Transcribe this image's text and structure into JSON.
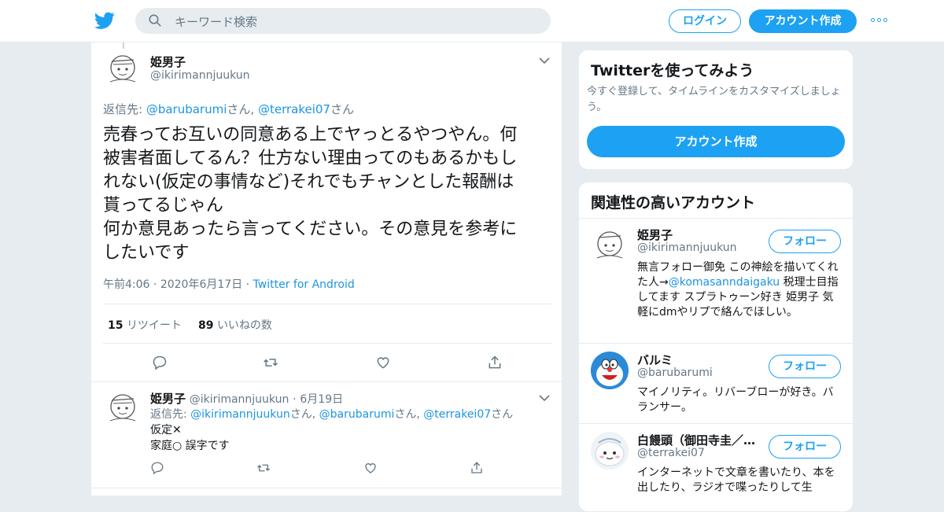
{
  "search": {
    "placeholder": "キーワード検索"
  },
  "header": {
    "login_label": "ログイン",
    "signup_label": "アカウント作成"
  },
  "main_tweet": {
    "name": "姫男子",
    "handle": "@ikirimannjuukun",
    "reply_prefix": "返信先: ",
    "reply_users": [
      "@barubarumi",
      "@terrakei07"
    ],
    "reply_suffix": "さん",
    "text_lines": [
      "売春ってお互いの同意ある上でヤっとるやつやん。何",
      "被害者面してるん？仕方ない理由ってのもあるかもし",
      "れない(仮定の事情など)それでもチャンとした報酬は",
      "貰ってるじゃん",
      "何か意見あったら言ってください。その意見を参考に",
      "したいです"
    ],
    "time": "午前4:06",
    "date": "2020年6月17日",
    "via": "Twitter for Android",
    "retweets": "15",
    "retweets_label": "リツイート",
    "likes": "89",
    "likes_label": "いいねの数"
  },
  "reply_tweet": {
    "name": "姫男子",
    "handle": "@ikirimannjuukun",
    "date": "6月19日",
    "reply_prefix": "返信先: ",
    "reply_users": [
      "@ikirimannjuukun",
      "@barubarumi",
      "@terrakei07"
    ],
    "reply_suffix": "さん",
    "text_lines": [
      "仮定✕",
      "家庭○ 誤字です"
    ]
  },
  "signup_card": {
    "title": "Twitterを使ってみよう",
    "subtitle": "今すぐ登録して、タイムラインをカスタマイズしましょう。",
    "button": "アカウント作成"
  },
  "related": {
    "title": "関連性の高いアカウント",
    "follow_label": "フォロー",
    "accounts": [
      {
        "name": "姫男子",
        "handle": "@ikirimannjuukun",
        "bio_before": "無言フォロー御免 この神絵を描いてくれた人→",
        "bio_link": "@komasanndaigaku",
        "bio_after": " 税理士目指してます スプラトゥーン好き 姫男子 気軽にdmやリプで絡んでほしい。"
      },
      {
        "name": "バルミ",
        "handle": "@barubarumi",
        "bio_before": "マイノリティ。リバーブローが好き。バランサー。",
        "bio_link": "",
        "bio_after": ""
      },
      {
        "name": "白饅頭（御田寺圭／…",
        "handle": "@terrakei07",
        "bio_before": "インターネットで文章を書いたり、本を出したり、ラジオで喋ったりして生",
        "bio_link": "",
        "bio_after": ""
      }
    ]
  },
  "colors": {
    "accent": "#1da1f2",
    "link": "#1b95e0",
    "muted": "#657786",
    "background": "#e6ecf0"
  }
}
